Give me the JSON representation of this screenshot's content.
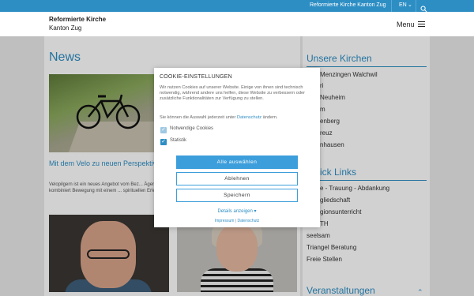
{
  "topbar": {
    "site_link": "Reformierte Kirche Kanton Zug",
    "language": "EN",
    "language_chevron": "chevron-down-icon",
    "search_icon": "search-icon"
  },
  "header": {
    "brand_line1": "Reformierte Kirche",
    "brand_line2": "Kanton Zug",
    "menu_label": "Menu",
    "menu_icon": "hamburger-icon"
  },
  "main": {
    "news_heading": "News",
    "article1": {
      "title": "Mit dem Velo zu neuen Perspektiven",
      "teaser": "Velopilgern ist ein neues Angebot vom Bez... Ägen und kombiniert Bewegung mit einem ... spirituellen Erlebnis."
    }
  },
  "sidebar": {
    "kirchen_heading": "Unsere Kirchen",
    "kirchen_items": [
      "Menzingen Walchwil",
      "ri",
      "Neuheim",
      "m",
      "enberg",
      "reuz",
      "nhausen"
    ],
    "quicklinks_heading": "ick Links",
    "quicklinks_items": [
      "e - Trauung - Abdankung",
      "gliedschaft",
      "gionsunterricht",
      "TH",
      "seelsam",
      "Triangel Beratung",
      "Freie Stellen"
    ],
    "events_heading": "Veranstaltungen"
  },
  "cookie": {
    "title": "COOKIE-EINSTELLUNGEN",
    "text": "Wir nutzen Cookies auf unserer Website. Einige von ihnen sind technisch notwendig, während andere uns helfen, diese Website zu verbessern oder zusätzliche Funktionalitäten zur Verfügung zu stellen.",
    "change_text_before": "Sie können die Auswahl jederzeit unter",
    "change_link": "Datenschutz",
    "change_text_after": "ändern.",
    "options": [
      {
        "label": "Notwendige Cookies",
        "checked": true,
        "disabled": true
      },
      {
        "label": "Statistik",
        "checked": true,
        "disabled": false
      }
    ],
    "btn_all": "Alle auswählen",
    "btn_reject": "Ablehnen",
    "btn_save": "Speichern",
    "details": "Details anzeigen",
    "footer_impressum": "Impressum",
    "footer_separator": "|",
    "footer_datenschutz": "Datenschutz"
  },
  "colors": {
    "brand_blue": "#2d8ec4",
    "button_blue": "#3c9edb"
  }
}
